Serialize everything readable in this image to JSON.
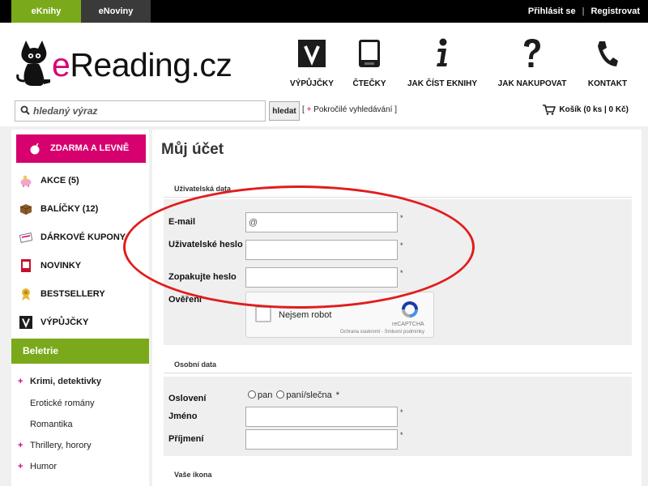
{
  "topbar": {
    "tabs": [
      "eKnihy",
      "eNoviny"
    ],
    "login": "Přihlásit se",
    "separator": "|",
    "register": "Registrovat"
  },
  "brand": {
    "logo_prefix": "e",
    "logo_rest": "Reading.cz",
    "accent": "#d6007a",
    "green": "#7aaa1b"
  },
  "nav": [
    {
      "label": "VÝPŮJČKY",
      "icon": "v-badge-icon"
    },
    {
      "label": "ČTEČKY",
      "icon": "ereader-icon"
    },
    {
      "label": "JAK ČÍST EKNIHY",
      "icon": "info-icon"
    },
    {
      "label": "JAK NAKUPOVAT",
      "icon": "question-icon"
    },
    {
      "label": "KONTAKT",
      "icon": "phone-icon"
    }
  ],
  "search": {
    "placeholder": "hledaný výraz",
    "button": "hledat",
    "advanced_open": "[",
    "advanced_plus": "+",
    "advanced_label": "Pokročilé vyhledávání",
    "advanced_close": "]"
  },
  "cart": {
    "label": "Košík (0 ks | 0 Kč)"
  },
  "sidebar": {
    "promo": "ZDARMA A LEVNĚ",
    "items": [
      {
        "label": "AKCE (5)",
        "icon": "piggy-bank-icon"
      },
      {
        "label": "BALÍČKY (12)",
        "icon": "package-icon"
      },
      {
        "label": "DÁRKOVÉ KUPONY",
        "icon": "gift-voucher-icon"
      },
      {
        "label": "NOVINKY",
        "icon": "new-badge-icon"
      },
      {
        "label": "BESTSELLERY",
        "icon": "award-icon"
      },
      {
        "label": "VÝPŮJČKY",
        "icon": "v-badge-icon"
      }
    ],
    "category_header": "Beletrie",
    "categories": [
      {
        "label": "Krimi, detektivky",
        "plus": true,
        "bold": true
      },
      {
        "label": "Erotické romány",
        "plus": false
      },
      {
        "label": "Romantika",
        "plus": false
      },
      {
        "label": "Thrillery, horory",
        "plus": true
      },
      {
        "label": "Humor",
        "plus": true
      }
    ]
  },
  "main": {
    "title": "Můj účet",
    "user_section": {
      "title": "Uživatelská data",
      "email_label": "E-mail",
      "email_value": "@",
      "password_label": "Uživatelské heslo",
      "password_repeat_label": "Zopakujte heslo",
      "verify_label": "Ověření",
      "required_mark": "*"
    },
    "captcha": {
      "label": "Nejsem robot",
      "brand": "reCAPTCHA",
      "links": "Ochrana soukromí - Smluvní podmínky"
    },
    "personal_section": {
      "title": "Osobní data",
      "salutation_label": "Oslovení",
      "options": [
        "pan",
        "paní/slečna"
      ],
      "required_mark": "*",
      "first_name_label": "Jméno",
      "last_name_label": "Příjmení"
    },
    "icon_section": {
      "title": "Vaše ikona"
    }
  }
}
